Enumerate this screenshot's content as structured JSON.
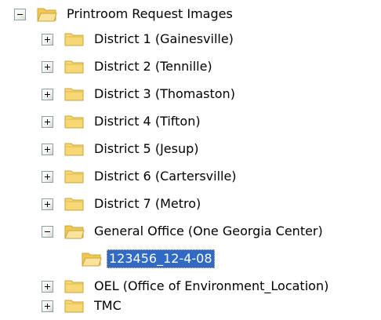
{
  "tree": {
    "root": {
      "label": "Printroom Request Images",
      "state": "expanded",
      "icon": "folder-open-icon"
    },
    "children": [
      {
        "label": "District 1 (Gainesville)",
        "state": "collapsed",
        "icon": "folder-icon"
      },
      {
        "label": "District 2 (Tennille)",
        "state": "collapsed",
        "icon": "folder-icon"
      },
      {
        "label": "District 3 (Thomaston)",
        "state": "collapsed",
        "icon": "folder-icon"
      },
      {
        "label": "District 4 (Tifton)",
        "state": "collapsed",
        "icon": "folder-icon"
      },
      {
        "label": "District 5 (Jesup)",
        "state": "collapsed",
        "icon": "folder-icon"
      },
      {
        "label": "District 6 (Cartersville)",
        "state": "collapsed",
        "icon": "folder-icon"
      },
      {
        "label": "District 7 (Metro)",
        "state": "collapsed",
        "icon": "folder-icon"
      },
      {
        "label": "General Office (One Georgia Center)",
        "state": "expanded",
        "icon": "folder-open-icon",
        "children": [
          {
            "label": "123456_12-4-08",
            "selected": true,
            "icon": "folder-open-icon"
          }
        ]
      },
      {
        "label": "OEL (Office of Environment_Location)",
        "state": "collapsed",
        "icon": "folder-icon"
      },
      {
        "label": "TMC",
        "state": "collapsed",
        "icon": "folder-icon"
      }
    ]
  },
  "colors": {
    "selection": "#316ac5",
    "folder_fill": "#f8d775",
    "folder_edge": "#c6a53c",
    "expander_border": "#8f9ea8"
  }
}
